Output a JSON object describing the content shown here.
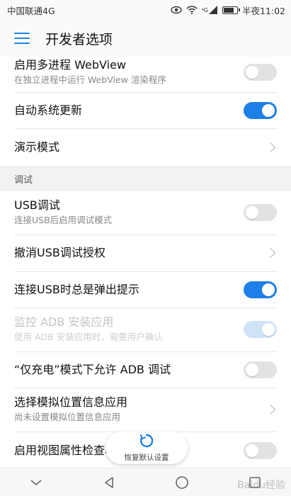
{
  "status_bar": {
    "carrier": "中国联通4G",
    "signal_label": "⁴G",
    "time": "半夜11:02",
    "battery_level": 0.85
  },
  "app_bar": {
    "title": "开发者选项"
  },
  "settings": {
    "multi_webview": {
      "title": "启用多进程 WebView",
      "subtitle": "在独立进程中运行 WebView 渲染程序",
      "state": "off"
    },
    "auto_update": {
      "title": "自动系统更新",
      "state": "on"
    },
    "demo_mode": {
      "title": "演示模式"
    },
    "debug_section": {
      "label": "调试"
    },
    "usb_debug": {
      "title": "USB调试",
      "subtitle": "连接USB后启用调试模式",
      "state": "off"
    },
    "revoke_usb": {
      "title": "撤消USB调试授权"
    },
    "usb_prompt": {
      "title": "连接USB时总是弹出提示",
      "state": "on"
    },
    "adb_monitor": {
      "title": "监控 ADB 安装应用",
      "subtitle": "使用 ADB 安装应用时，需要用户确认",
      "state": "on-disabled"
    },
    "charge_adb": {
      "title": "“仅充电”模式下允许 ADB 调试",
      "state": "off"
    },
    "mock_location": {
      "title": "选择模拟位置信息应用",
      "subtitle": "尚未设置模拟位置信息应用"
    },
    "view_attr": {
      "title": "启用视图属性检查功能",
      "state": "off"
    }
  },
  "restore_button": {
    "label": "恢复默认设置"
  },
  "watermark": {
    "text": "Baidu经验"
  },
  "colors": {
    "accent": "#1e7fe8",
    "toggle_off": "#e2e2e2",
    "section_bg": "#f2f2f2"
  },
  "icons": [
    "menu-icon",
    "eye-icon",
    "wifi-icon",
    "signal-icon",
    "battery-icon",
    "chevron-right-icon",
    "refresh-icon",
    "back-icon",
    "home-icon",
    "recents-icon"
  ]
}
